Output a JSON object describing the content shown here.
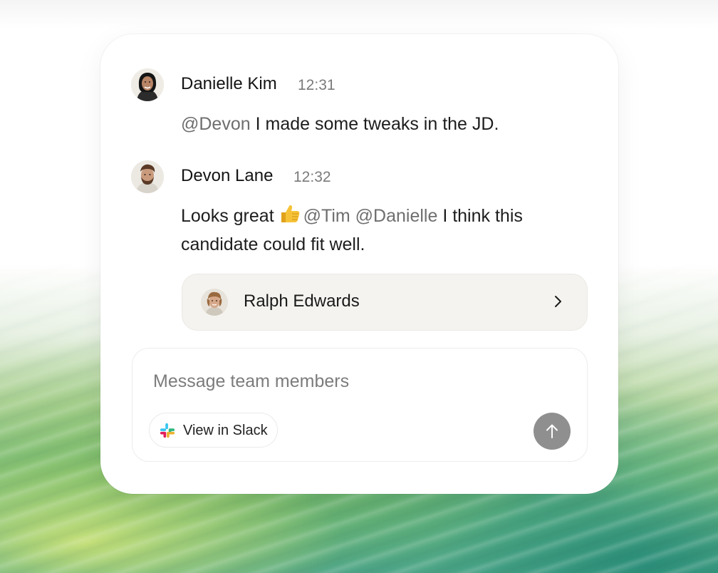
{
  "messages": [
    {
      "author": "Danielle Kim",
      "time": "12:31",
      "mention": "@Devon",
      "text": " I made some tweaks in the JD.",
      "avatar_icon": "woman-avatar"
    },
    {
      "author": "Devon Lane",
      "time": "12:32",
      "text_before": "Looks great ",
      "emoji_icon": "thumbs-up-emoji",
      "mention_1": "@Tim",
      "mention_2": "@Danielle",
      "text_line1_end": " I think this",
      "text_line2": "candidate could fit well.",
      "avatar_icon": "bearded-man-avatar"
    }
  ],
  "candidate": {
    "name": "Ralph Edwards",
    "avatar_icon": "man-avatar",
    "chevron_icon": "chevron-right-icon"
  },
  "composer": {
    "placeholder": "Message team members",
    "value": "",
    "slack_button_label": "View in Slack",
    "slack_icon": "slack-logo-icon",
    "send_icon": "arrow-up-icon"
  },
  "colors": {
    "mention": "#6e6e6e",
    "send_button": "#8f8f8f",
    "candidate_card": "#f4f3ef",
    "background_green": "#4ea58a",
    "background_lime": "#d6e878"
  }
}
